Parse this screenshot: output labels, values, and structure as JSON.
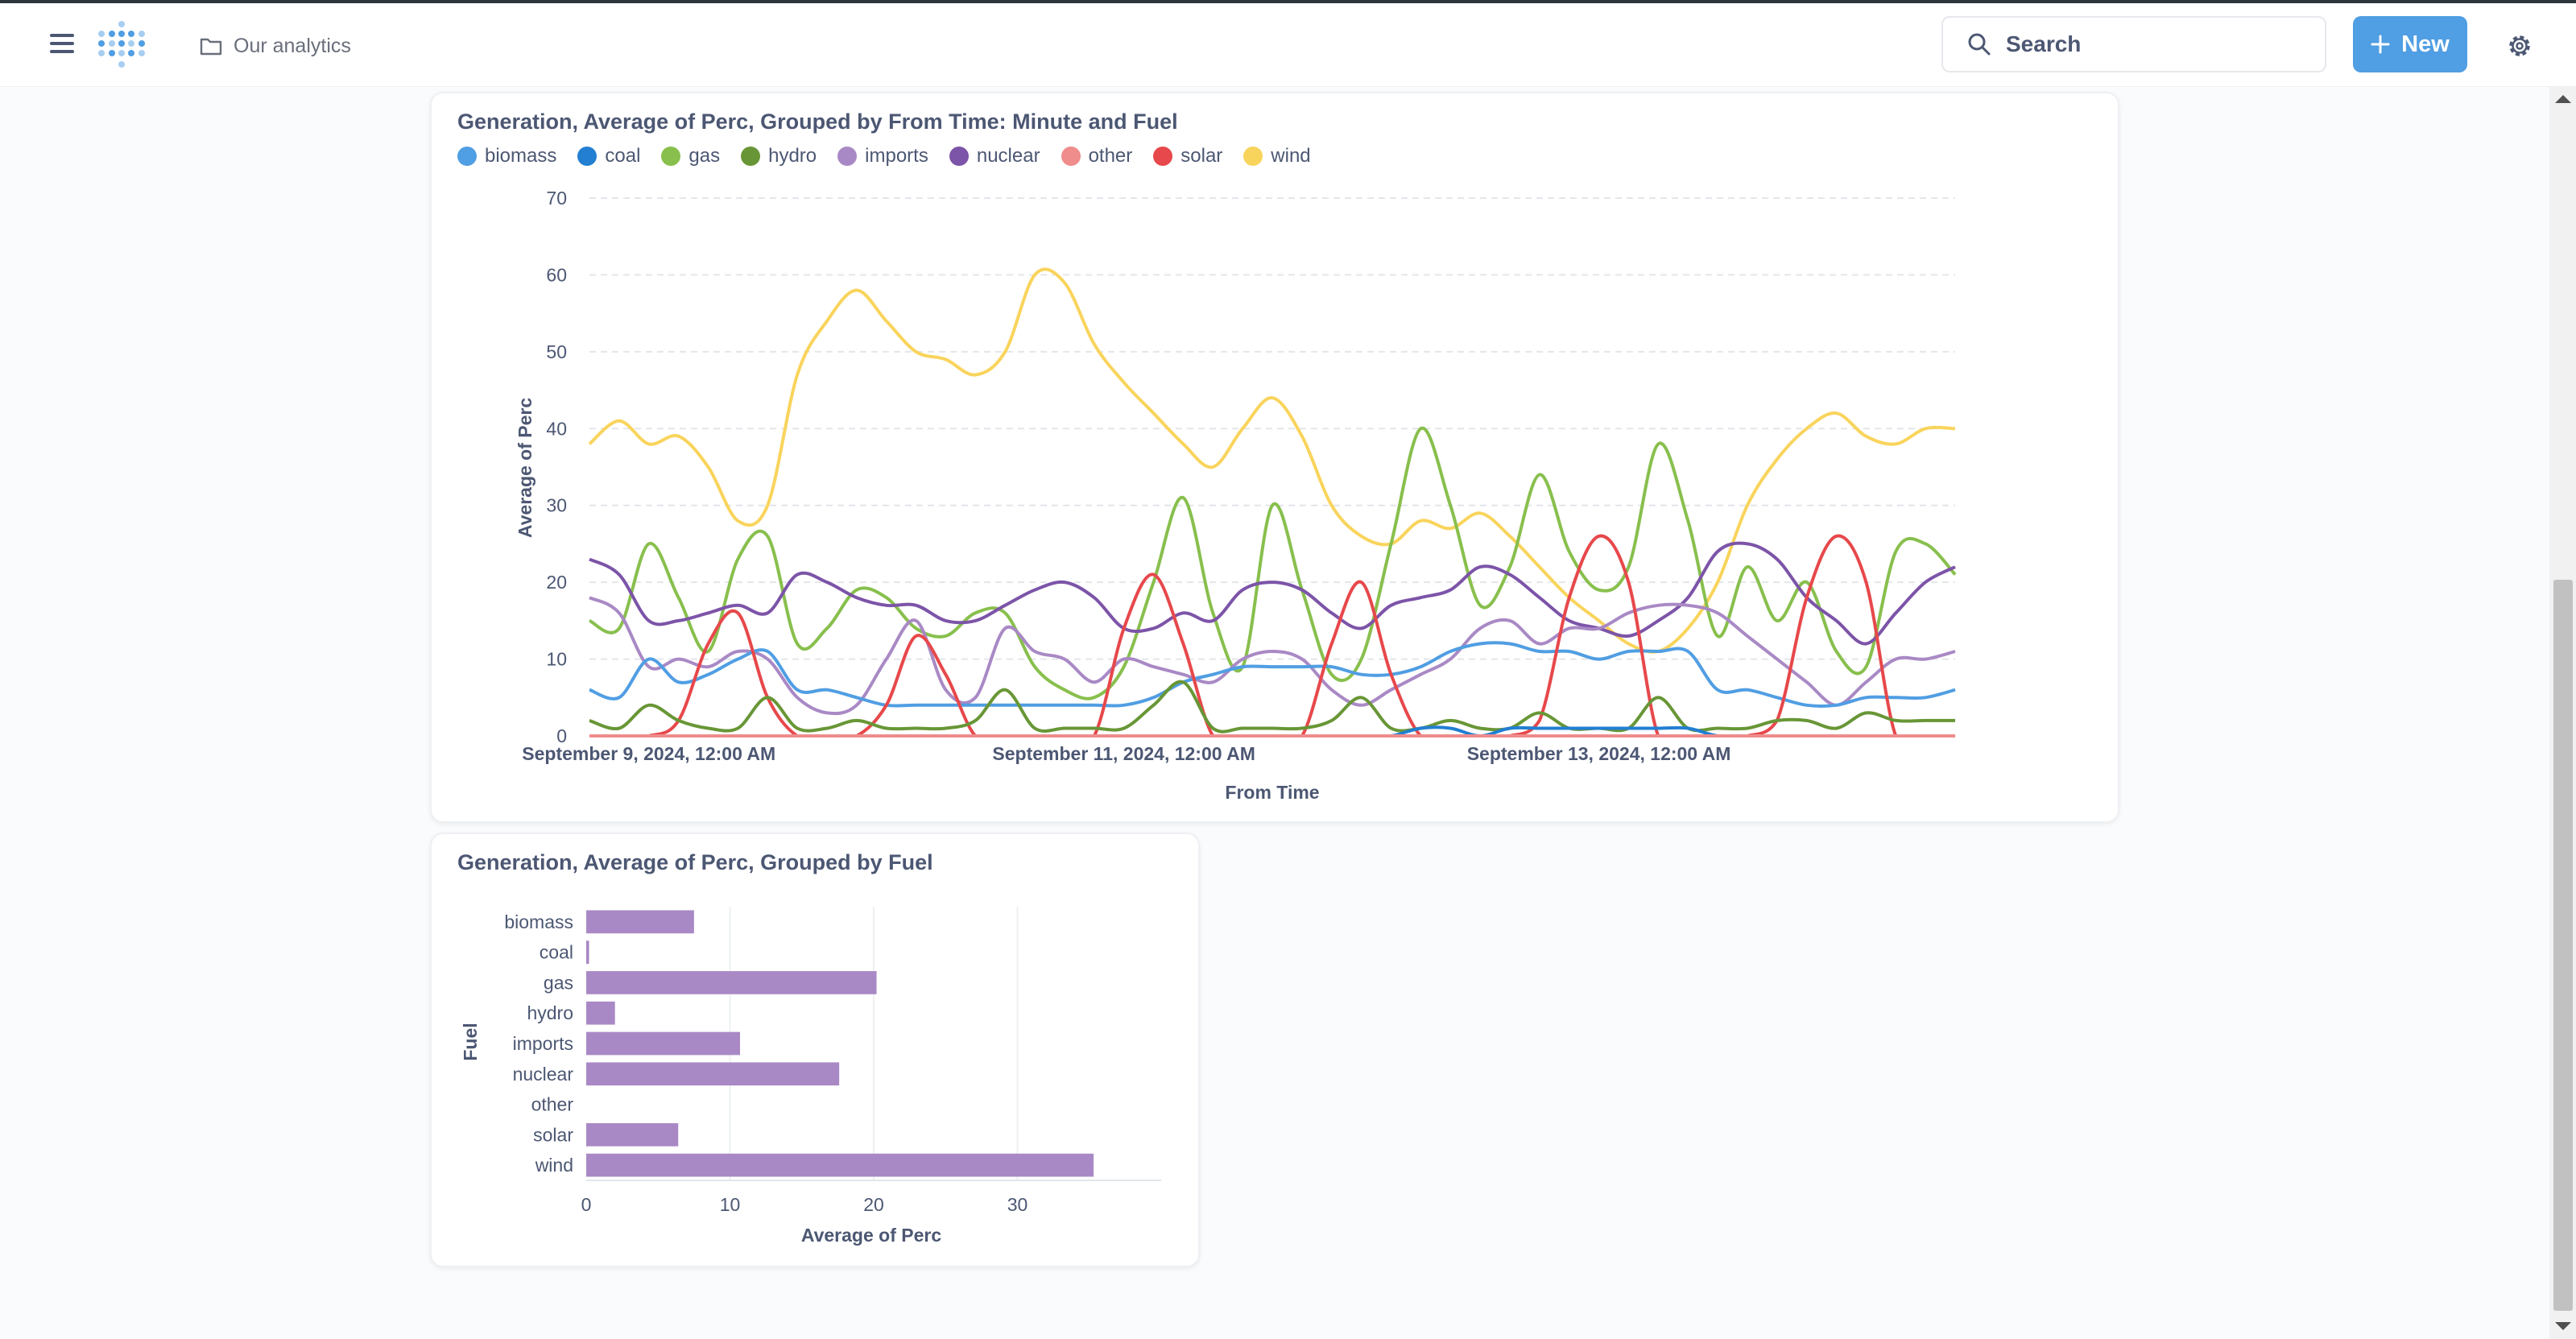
{
  "header": {
    "breadcrumb": "Our analytics",
    "search_placeholder": "Search",
    "new_label": "New"
  },
  "line_chart": {
    "title": "Generation, Average of Perc, Grouped by From Time: Minute and Fuel",
    "xlabel": "From Time",
    "ylabel": "Average of Perc"
  },
  "bar_chart": {
    "title": "Generation, Average of Perc, Grouped by Fuel",
    "xlabel": "Average of Perc",
    "ylabel": "Fuel"
  },
  "legend": [
    {
      "name": "biomass",
      "color": "#509ee3"
    },
    {
      "name": "coal",
      "color": "#227fd2"
    },
    {
      "name": "gas",
      "color": "#88bf4d"
    },
    {
      "name": "hydro",
      "color": "#689636"
    },
    {
      "name": "imports",
      "color": "#a989c5"
    },
    {
      "name": "nuclear",
      "color": "#7c54a8"
    },
    {
      "name": "other",
      "color": "#ef8c8c"
    },
    {
      "name": "solar",
      "color": "#e7484b"
    },
    {
      "name": "wind",
      "color": "#f9d45c"
    }
  ],
  "chart_data": [
    {
      "type": "line",
      "title": "Generation, Average of Perc, Grouped by From Time: Minute and Fuel",
      "xlabel": "From Time",
      "ylabel": "Average of Perc",
      "x_tick_labels": [
        "September 9, 2024, 12:00 AM",
        "September 11, 2024, 12:00 AM",
        "September 13, 2024, 12:00 AM"
      ],
      "x_range": [
        "2024-09-08T18:00",
        "2024-09-14T12:00"
      ],
      "ylim": [
        0,
        70
      ],
      "y_ticks": [
        0,
        10,
        20,
        30,
        40,
        50,
        60,
        70
      ],
      "grid": "horizontal dashed",
      "legend_position": "top-left",
      "x": [
        "2024-09-08T18:00",
        "2024-09-08T21:00",
        "2024-09-09T00:00",
        "2024-09-09T03:00",
        "2024-09-09T06:00",
        "2024-09-09T09:00",
        "2024-09-09T12:00",
        "2024-09-09T15:00",
        "2024-09-09T18:00",
        "2024-09-09T21:00",
        "2024-09-10T00:00",
        "2024-09-10T03:00",
        "2024-09-10T06:00",
        "2024-09-10T09:00",
        "2024-09-10T12:00",
        "2024-09-10T15:00",
        "2024-09-10T18:00",
        "2024-09-10T21:00",
        "2024-09-11T00:00",
        "2024-09-11T03:00",
        "2024-09-11T06:00",
        "2024-09-11T09:00",
        "2024-09-11T12:00",
        "2024-09-11T15:00",
        "2024-09-11T18:00",
        "2024-09-11T21:00",
        "2024-09-12T00:00",
        "2024-09-12T03:00",
        "2024-09-12T06:00",
        "2024-09-12T09:00",
        "2024-09-12T12:00",
        "2024-09-12T15:00",
        "2024-09-12T18:00",
        "2024-09-12T21:00",
        "2024-09-13T00:00",
        "2024-09-13T03:00",
        "2024-09-13T06:00",
        "2024-09-13T09:00",
        "2024-09-13T12:00",
        "2024-09-13T15:00",
        "2024-09-13T18:00",
        "2024-09-13T21:00",
        "2024-09-14T00:00",
        "2024-09-14T03:00",
        "2024-09-14T06:00",
        "2024-09-14T09:00",
        "2024-09-14T12:00"
      ],
      "series": [
        {
          "name": "wind",
          "values": [
            38,
            41,
            38,
            39,
            35,
            28,
            30,
            47,
            54,
            58,
            54,
            50,
            49,
            47,
            50,
            60,
            59,
            51,
            46,
            42,
            38,
            35,
            40,
            44,
            39,
            30,
            26,
            25,
            28,
            27,
            29,
            26,
            22,
            18,
            15,
            12,
            11,
            14,
            20,
            30,
            36,
            40,
            42,
            39,
            38,
            40,
            40
          ]
        },
        {
          "name": "gas",
          "values": [
            15,
            14,
            25,
            18,
            11,
            23,
            26,
            12,
            14,
            19,
            18,
            14,
            13,
            16,
            16,
            9,
            6,
            5,
            9,
            20,
            31,
            16,
            9,
            30,
            19,
            8,
            10,
            25,
            40,
            30,
            17,
            22,
            34,
            24,
            19,
            22,
            38,
            28,
            13,
            22,
            15,
            20,
            11,
            9,
            24,
            25,
            21
          ]
        },
        {
          "name": "nuclear",
          "values": [
            23,
            21,
            15,
            15,
            16,
            17,
            16,
            21,
            20,
            18,
            17,
            17,
            15,
            15,
            17,
            19,
            20,
            18,
            14,
            14,
            16,
            15,
            19,
            20,
            19,
            16,
            14,
            17,
            18,
            19,
            22,
            21,
            18,
            15,
            14,
            13,
            15,
            18,
            24,
            25,
            23,
            18,
            15,
            12,
            16,
            20,
            22
          ]
        },
        {
          "name": "imports",
          "values": [
            18,
            16,
            9,
            10,
            9,
            11,
            10,
            5,
            3,
            4,
            10,
            15,
            6,
            5,
            14,
            11,
            10,
            7,
            10,
            9,
            8,
            7,
            10,
            11,
            10,
            6,
            4,
            6,
            8,
            10,
            14,
            15,
            12,
            14,
            14,
            16,
            17,
            17,
            16,
            13,
            10,
            7,
            4,
            7,
            10,
            10,
            11
          ]
        },
        {
          "name": "biomass",
          "values": [
            6,
            5,
            10,
            7,
            8,
            10,
            11,
            6,
            6,
            5,
            4,
            4,
            4,
            4,
            4,
            4,
            4,
            4,
            4,
            5,
            7,
            8,
            9,
            9,
            9,
            9,
            8,
            8,
            9,
            11,
            12,
            12,
            11,
            11,
            10,
            11,
            11,
            11,
            6,
            6,
            5,
            4,
            4,
            5,
            5,
            5,
            6
          ]
        },
        {
          "name": "solar",
          "values": [
            0,
            0,
            0,
            2,
            12,
            16,
            5,
            0,
            0,
            0,
            4,
            13,
            8,
            0,
            0,
            0,
            0,
            0,
            14,
            21,
            12,
            0,
            0,
            0,
            0,
            12,
            20,
            8,
            0,
            0,
            0,
            0,
            2,
            18,
            26,
            20,
            0,
            0,
            0,
            0,
            2,
            18,
            26,
            20,
            0,
            0,
            0
          ]
        },
        {
          "name": "hydro",
          "values": [
            2,
            1,
            4,
            2,
            1,
            1,
            5,
            1,
            1,
            2,
            1,
            1,
            1,
            2,
            6,
            1,
            1,
            1,
            1,
            4,
            7,
            1,
            1,
            1,
            1,
            2,
            5,
            1,
            1,
            2,
            1,
            1,
            3,
            1,
            1,
            1,
            5,
            1,
            1,
            1,
            2,
            2,
            1,
            3,
            2,
            2,
            2
          ]
        },
        {
          "name": "coal",
          "values": [
            0,
            0,
            0,
            0,
            0,
            0,
            0,
            0,
            0,
            0,
            0,
            0,
            0,
            0,
            0,
            0,
            0,
            0,
            0,
            0,
            0,
            0,
            0,
            0,
            0,
            0,
            0,
            0,
            1,
            1,
            0,
            1,
            1,
            1,
            1,
            1,
            1,
            1,
            0,
            0,
            0,
            0,
            0,
            0,
            0,
            0,
            0
          ]
        },
        {
          "name": "other",
          "values": [
            0,
            0,
            0,
            0,
            0,
            0,
            0,
            0,
            0,
            0,
            0,
            0,
            0,
            0,
            0,
            0,
            0,
            0,
            0,
            0,
            0,
            0,
            0,
            0,
            0,
            0,
            0,
            0,
            0,
            0,
            0,
            0,
            0,
            0,
            0,
            0,
            0,
            0,
            0,
            0,
            0,
            0,
            0,
            0,
            0,
            0,
            0
          ]
        }
      ]
    },
    {
      "type": "bar",
      "orientation": "horizontal",
      "title": "Generation, Average of Perc, Grouped by Fuel",
      "xlabel": "Average of Perc",
      "ylabel": "Fuel",
      "categories": [
        "biomass",
        "coal",
        "gas",
        "hydro",
        "imports",
        "nuclear",
        "other",
        "solar",
        "wind"
      ],
      "values": [
        7.5,
        0.2,
        20.2,
        2.0,
        10.7,
        17.6,
        0.0,
        6.4,
        35.3
      ],
      "xlim": [
        0,
        40
      ],
      "x_ticks": [
        0,
        10,
        20,
        30
      ],
      "bar_color": "#a989c5"
    }
  ]
}
